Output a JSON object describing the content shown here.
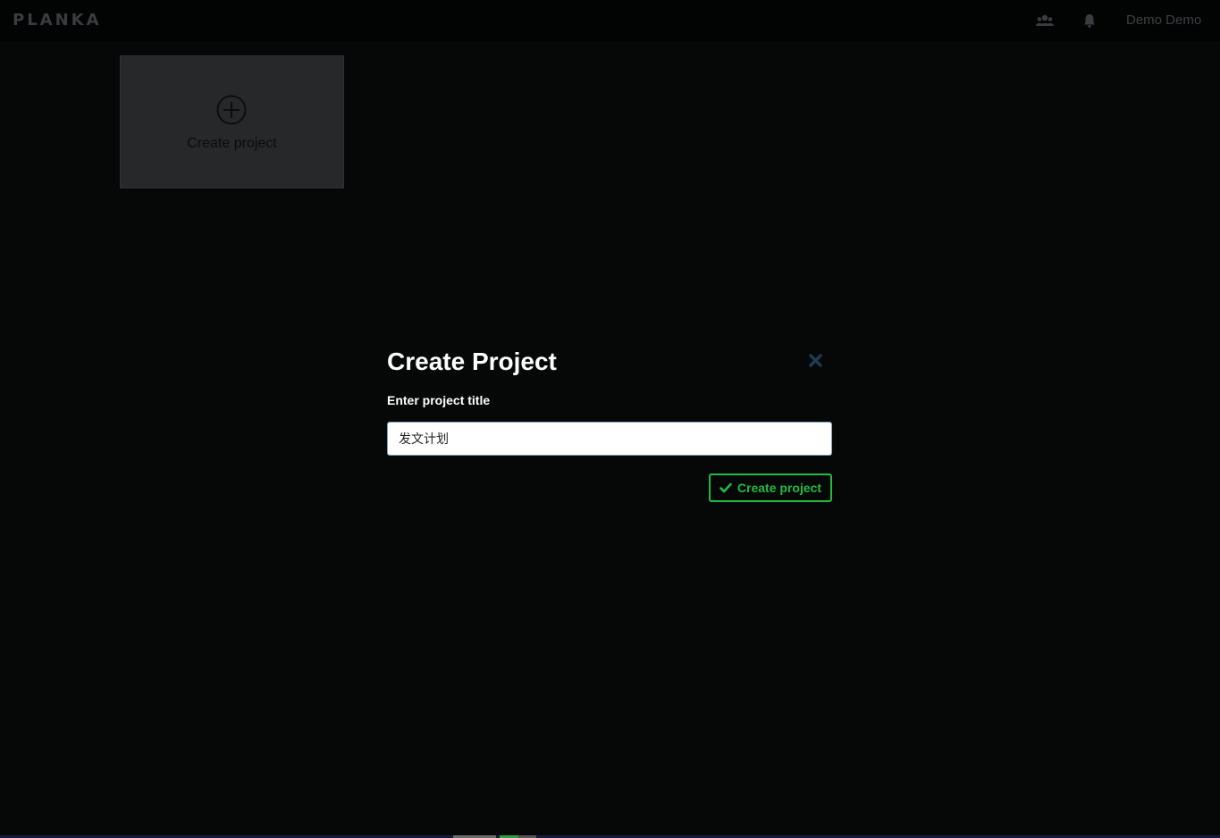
{
  "header": {
    "logo": "PLANKA",
    "users_icon": "users-icon",
    "notifications_icon": "bell-icon",
    "user_name": "Demo Demo"
  },
  "projects": {
    "create_card_label": "Create project",
    "create_card_icon": "plus-circle-icon"
  },
  "modal": {
    "title": "Create Project",
    "close_icon": "close-icon",
    "field_label": "Enter project title",
    "input_value": "发文计划",
    "submit_label": "Create project",
    "submit_icon": "check-icon"
  },
  "colors": {
    "background": "#060808",
    "accent_green": "#21ba45",
    "close_icon": "#1f3b55"
  }
}
